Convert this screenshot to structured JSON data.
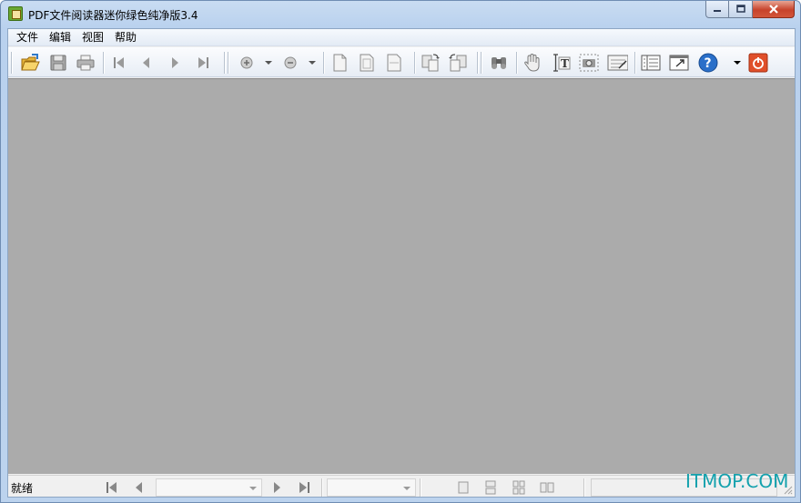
{
  "window": {
    "title": "PDF文件阅读器迷你绿色纯净版3.4",
    "buttons": {
      "minimize": "▭",
      "maximize": "▢",
      "close": "✕"
    }
  },
  "menu": {
    "items": [
      {
        "label": "文件"
      },
      {
        "label": "编辑"
      },
      {
        "label": "视图"
      },
      {
        "label": "帮助"
      }
    ]
  },
  "toolbar": {
    "buttons": [
      {
        "name": "open-icon"
      },
      {
        "name": "save-icon"
      },
      {
        "name": "print-icon"
      },
      {
        "name": "first-page-icon"
      },
      {
        "name": "prev-page-icon"
      },
      {
        "name": "next-page-icon"
      },
      {
        "name": "last-page-icon"
      },
      {
        "name": "zoom-in-icon"
      },
      {
        "name": "zoom-out-icon"
      },
      {
        "name": "actual-size-icon"
      },
      {
        "name": "fit-page-icon"
      },
      {
        "name": "fit-width-icon"
      },
      {
        "name": "rotate-cw-icon"
      },
      {
        "name": "rotate-ccw-icon"
      },
      {
        "name": "find-icon"
      },
      {
        "name": "hand-tool-icon"
      },
      {
        "name": "text-select-icon"
      },
      {
        "name": "snapshot-icon"
      },
      {
        "name": "annotate-icon"
      },
      {
        "name": "bookmarks-icon"
      },
      {
        "name": "fullscreen-icon"
      },
      {
        "name": "help-icon"
      },
      {
        "name": "exit-icon"
      }
    ]
  },
  "status": {
    "text": "就绪",
    "page_combo_value": "",
    "zoom_combo_value": ""
  },
  "colors": {
    "viewport_bg": "#ababab",
    "close_btn": "#c7432b",
    "accent_blue": "#2a6fc9",
    "exit_red": "#e04f2a"
  },
  "watermark": "ITMOP.COM"
}
